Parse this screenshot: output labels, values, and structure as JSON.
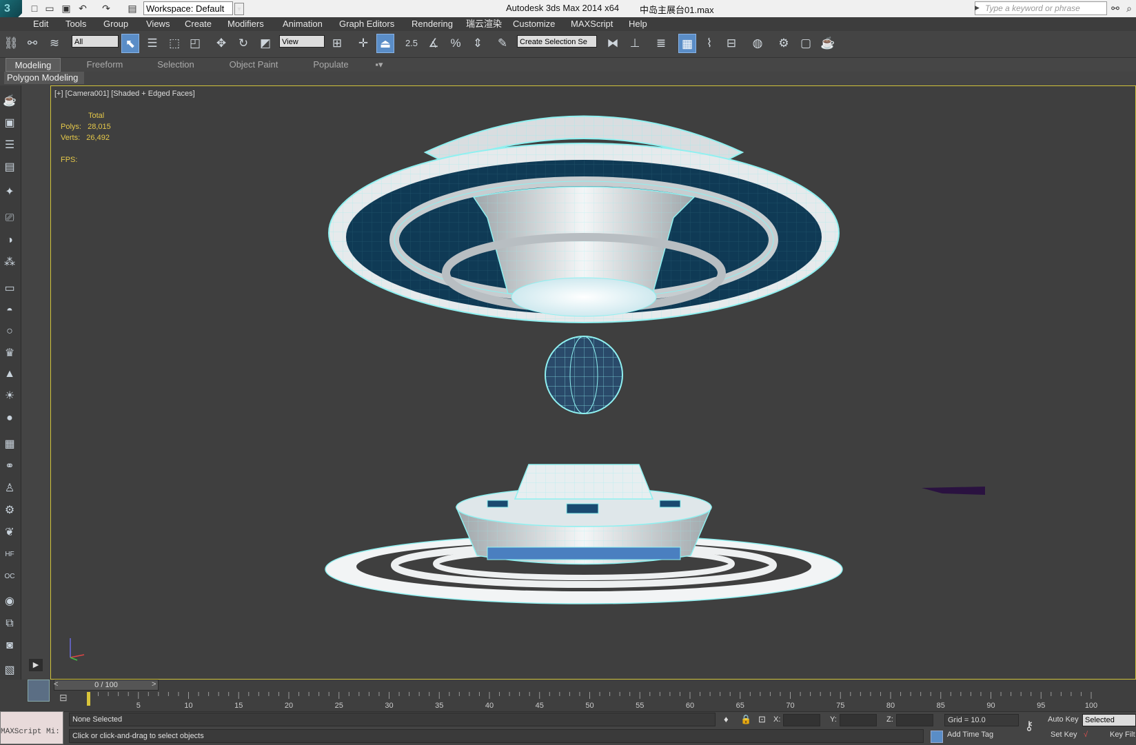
{
  "titlebar": {
    "workspace_label": "Workspace: Default",
    "app_title": "Autodesk 3ds Max  2014 x64",
    "file_title": "中岛主展台01.max",
    "search_placeholder": "Type a keyword or phrase"
  },
  "menu": [
    "Edit",
    "Tools",
    "Group",
    "Views",
    "Create",
    "Modifiers",
    "Animation",
    "Graph Editors",
    "Rendering",
    "瑞云渲染",
    "Customize",
    "MAXScript",
    "Help"
  ],
  "toolbar": {
    "selection_filter": "All",
    "ref_coord": "View",
    "snap_value": "2.5",
    "named_selection": "Create Selection Se"
  },
  "ribbon": {
    "tabs": [
      "Modeling",
      "Freeform",
      "Selection",
      "Object Paint",
      "Populate"
    ],
    "active_tab": "Modeling",
    "panel_label": "Polygon Modeling"
  },
  "viewport": {
    "label": "[+] [Camera001] [Shaded + Edged Faces]",
    "stats_header": "Total",
    "polys_label": "Polys:",
    "polys_value": "28,015",
    "verts_label": "Verts:",
    "verts_value": "26,492",
    "fps_label": "FPS:"
  },
  "timeline": {
    "slider_text": "0 / 100",
    "prev": "<",
    "next": ">",
    "ticks": [
      "5",
      "10",
      "15",
      "20",
      "25",
      "30",
      "35",
      "40",
      "45",
      "50",
      "55",
      "60",
      "65",
      "70",
      "75",
      "80",
      "85",
      "90",
      "95",
      "100"
    ]
  },
  "status": {
    "maxscript_text": "MAXScript Mi:",
    "selection_text": "None Selected",
    "prompt_text": "Click or click-and-drag to select objects",
    "x_label": "X:",
    "y_label": "Y:",
    "z_label": "Z:",
    "grid_text": "Grid = 10.0",
    "add_time_tag": "Add Time Tag",
    "auto_key": "Auto Key",
    "set_key": "Set Key",
    "selected_value": "Selected",
    "key_filters": "Key Filt"
  },
  "colors": {
    "viewport_bg": "#3f3f3f",
    "viewport_border": "#d2c43b",
    "stats_text": "#e6c94a",
    "active_button": "#5a8dc7",
    "wire": "#8ff0f0"
  }
}
